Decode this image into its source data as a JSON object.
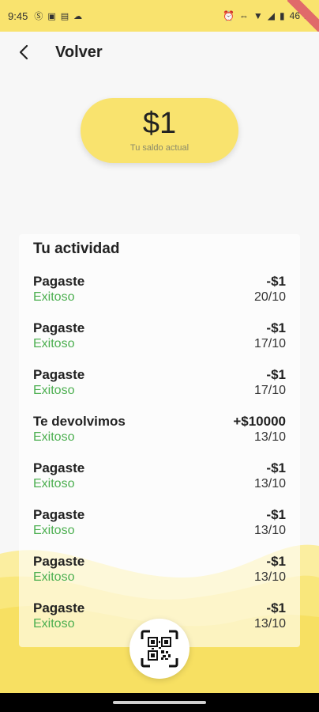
{
  "status_bar": {
    "time": "9:45",
    "left_icons": [
      "S",
      "31",
      "M",
      "cloud"
    ],
    "battery": "46 %",
    "right_icons": [
      "alarm-icon",
      "link-icon",
      "wifi-icon",
      "signal-icon",
      "battery-icon"
    ]
  },
  "header": {
    "back_icon": "chevron-left-icon",
    "title": "Volver"
  },
  "balance": {
    "amount": "$1",
    "caption": "Tu saldo actual"
  },
  "activity": {
    "title": "Tu actividad",
    "rows": [
      {
        "type": "Pagaste",
        "status": "Exitoso",
        "amount": "-$1",
        "date": "20/10"
      },
      {
        "type": "Pagaste",
        "status": "Exitoso",
        "amount": "-$1",
        "date": "17/10"
      },
      {
        "type": "Pagaste",
        "status": "Exitoso",
        "amount": "-$1",
        "date": "17/10"
      },
      {
        "type": "Te devolvimos",
        "status": "Exitoso",
        "amount": "+$10000",
        "date": "13/10"
      },
      {
        "type": "Pagaste",
        "status": "Exitoso",
        "amount": "-$1",
        "date": "13/10"
      },
      {
        "type": "Pagaste",
        "status": "Exitoso",
        "amount": "-$1",
        "date": "13/10"
      },
      {
        "type": "Pagaste",
        "status": "Exitoso",
        "amount": "-$1",
        "date": "13/10"
      },
      {
        "type": "Pagaste",
        "status": "Exitoso",
        "amount": "-$1",
        "date": "13/10"
      }
    ]
  },
  "qr_button": {
    "icon": "qr-scan-icon"
  },
  "colors": {
    "accent": "#f9e36e",
    "success": "#4caf50",
    "background": "#f7f7f7"
  }
}
